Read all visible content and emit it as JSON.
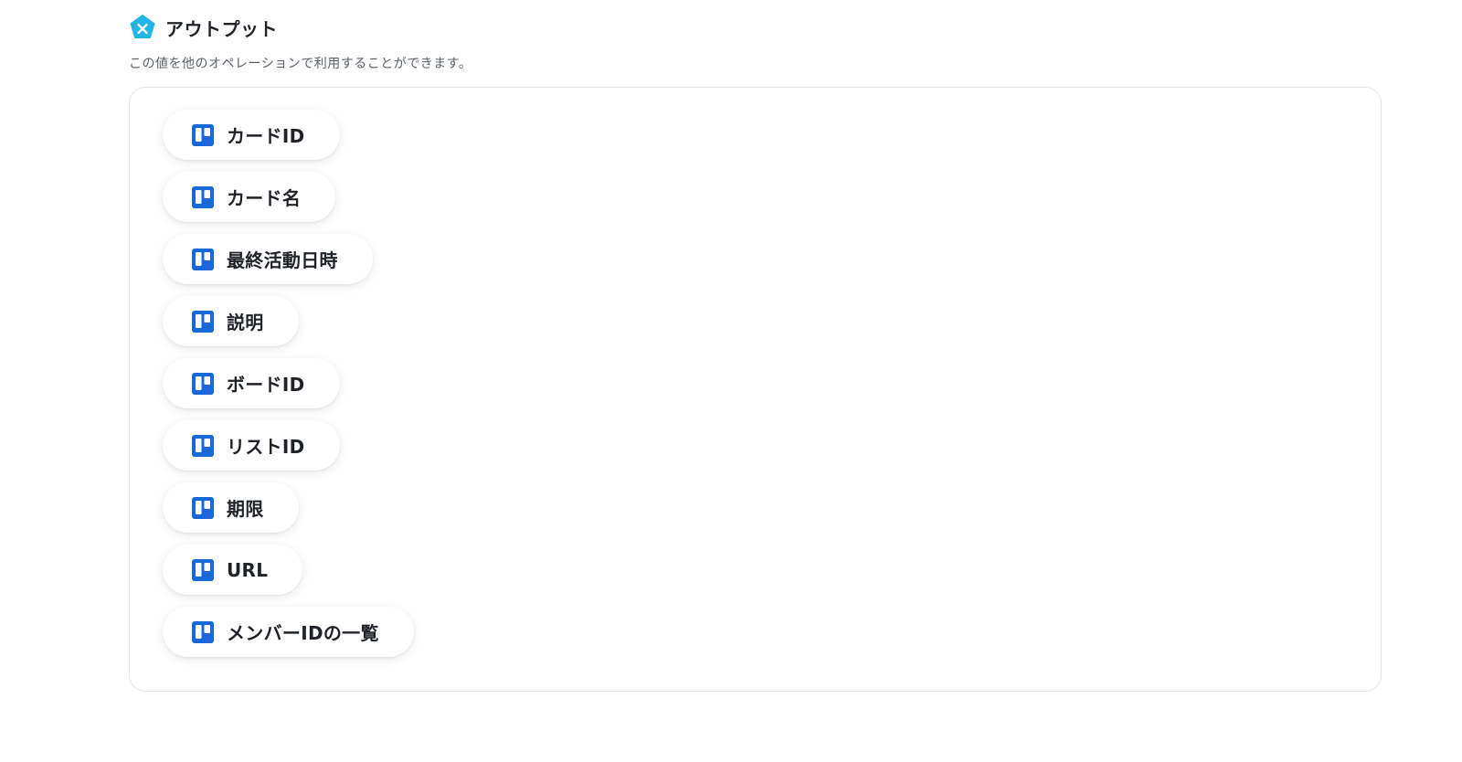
{
  "section": {
    "icon": "yoom-pentagon-icon",
    "title": "アウトプット",
    "description": "この値を他のオペレーションで利用することができます。"
  },
  "outputs": [
    {
      "label": "カードID",
      "icon": "trello-icon"
    },
    {
      "label": "カード名",
      "icon": "trello-icon"
    },
    {
      "label": "最終活動日時",
      "icon": "trello-icon"
    },
    {
      "label": "説明",
      "icon": "trello-icon"
    },
    {
      "label": "ボードID",
      "icon": "trello-icon"
    },
    {
      "label": "リストID",
      "icon": "trello-icon"
    },
    {
      "label": "期限",
      "icon": "trello-icon"
    },
    {
      "label": "URL",
      "icon": "trello-icon"
    },
    {
      "label": "メンバーIDの一覧",
      "icon": "trello-icon"
    }
  ],
  "colors": {
    "header_icon": "#1fb6e3",
    "trello_blue": "#1868db",
    "panel_border": "#e3e5e8"
  }
}
